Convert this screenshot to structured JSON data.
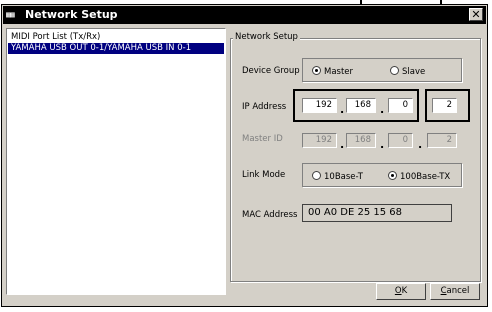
{
  "window": {
    "title": "Network Setup",
    "app_icon": "keyboard-app-icon",
    "close_glyph": "✕"
  },
  "port_list": {
    "header": "MIDI Port List (Tx/Rx)",
    "items": [
      "YAMAHA USB OUT 0-1/YAMAHA USB IN 0-1"
    ]
  },
  "network": {
    "group_label": "Network Setup",
    "device_group": {
      "label": "Device Group",
      "options": [
        "Master",
        "Slave"
      ],
      "selected": "Master"
    },
    "ip_address": {
      "label": "IP Address",
      "octets": [
        "192",
        "168",
        "0",
        "2"
      ]
    },
    "master_id": {
      "label": "Master ID",
      "octets": [
        "192",
        "168",
        "0",
        "2"
      ]
    },
    "link_mode": {
      "label": "Link Mode",
      "options": [
        "10Base-T",
        "100Base-TX"
      ],
      "selected": "100Base-TX"
    },
    "mac_address": {
      "label": "MAC Address",
      "value": "00 A0 DE 25 15 68"
    },
    "dot": "."
  },
  "buttons": {
    "ok": {
      "mnemonic": "O",
      "rest": "K"
    },
    "cancel": {
      "mnemonic": "C",
      "rest": "ancel"
    }
  },
  "colors": {
    "face": "#d4d0c8",
    "selection": "#000080",
    "titlebar": "#000000"
  }
}
